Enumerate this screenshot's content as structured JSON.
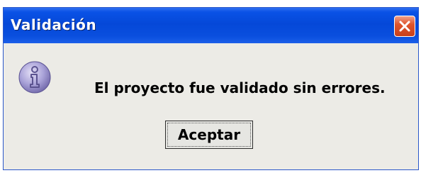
{
  "window": {
    "title": "Validación"
  },
  "title_bar": {
    "close_icon": "close-icon"
  },
  "body": {
    "icon": "info-icon",
    "message": "El proyecto fue validado sin errores."
  },
  "buttons": {
    "accept_label": "Aceptar"
  },
  "colors": {
    "title_bar": "#0548d8",
    "dialog_background": "#ecebe6",
    "close_button": "#e0552c",
    "icon": "#8f86c8"
  }
}
